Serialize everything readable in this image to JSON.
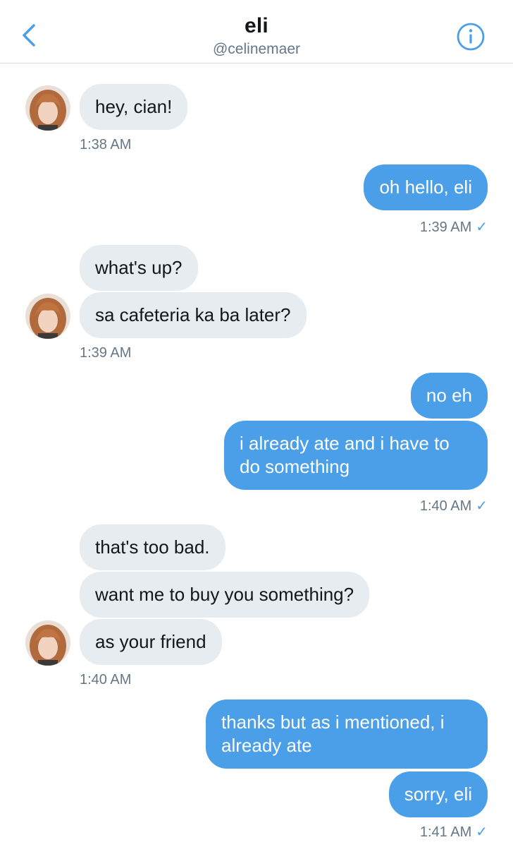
{
  "header": {
    "name": "eli",
    "handle": "@celinemaer"
  },
  "messages": [
    {
      "text": "hey, cian!"
    },
    {
      "text": "oh hello, eli"
    },
    {
      "text": "what's up?"
    },
    {
      "text": "sa cafeteria ka ba later?"
    },
    {
      "text": "no eh"
    },
    {
      "text": "i already ate and i have to do something"
    },
    {
      "text": "that's too bad."
    },
    {
      "text": "want me to buy you something?"
    },
    {
      "text": "as your friend"
    },
    {
      "text": "thanks but as i mentioned, i already ate"
    },
    {
      "text": "sorry, eli"
    }
  ],
  "timestamps": [
    "1:38 AM",
    "1:39 AM",
    "1:39 AM",
    "1:40 AM",
    "1:40 AM",
    "1:41 AM"
  ],
  "read_mark": "✓",
  "colors": {
    "accent": "#4a9fe8",
    "incoming_bubble": "#e6ecf0",
    "timestamp": "#657786"
  }
}
